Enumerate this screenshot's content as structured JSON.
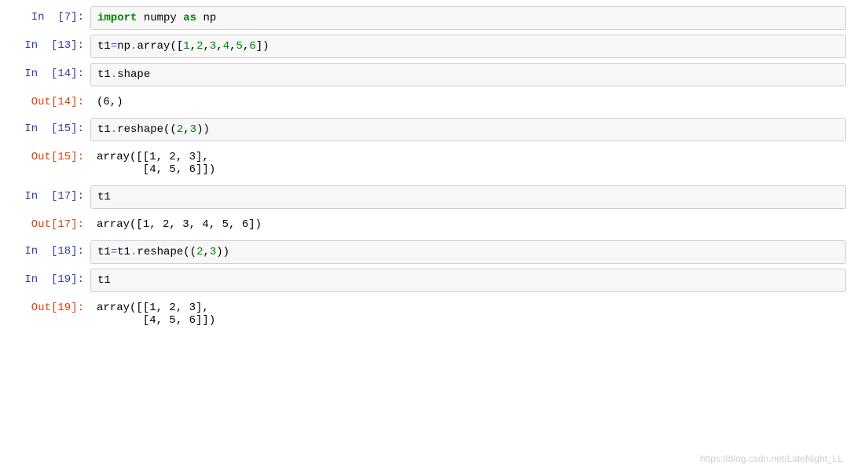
{
  "cells": [
    {
      "inPrompt": "In  [7]:",
      "inputTokens": [
        {
          "cls": "tok-kw-import",
          "text": "import"
        },
        {
          "cls": "tok-plain",
          "text": " numpy "
        },
        {
          "cls": "tok-kw-as",
          "text": "as"
        },
        {
          "cls": "tok-plain",
          "text": " np"
        }
      ]
    },
    {
      "inPrompt": "In  [13]:",
      "inputTokens": [
        {
          "cls": "tok-plain",
          "text": "t1"
        },
        {
          "cls": "tok-op",
          "text": "="
        },
        {
          "cls": "tok-plain",
          "text": "np"
        },
        {
          "cls": "tok-op",
          "text": "."
        },
        {
          "cls": "tok-plain",
          "text": "array(["
        },
        {
          "cls": "tok-num",
          "text": "1"
        },
        {
          "cls": "tok-plain",
          "text": ","
        },
        {
          "cls": "tok-num",
          "text": "2"
        },
        {
          "cls": "tok-plain",
          "text": ","
        },
        {
          "cls": "tok-num",
          "text": "3"
        },
        {
          "cls": "tok-plain",
          "text": ","
        },
        {
          "cls": "tok-num",
          "text": "4"
        },
        {
          "cls": "tok-plain",
          "text": ","
        },
        {
          "cls": "tok-num",
          "text": "5"
        },
        {
          "cls": "tok-plain",
          "text": ","
        },
        {
          "cls": "tok-num",
          "text": "6"
        },
        {
          "cls": "tok-plain",
          "text": "])"
        }
      ]
    },
    {
      "inPrompt": "In  [14]:",
      "inputTokens": [
        {
          "cls": "tok-plain",
          "text": "t1"
        },
        {
          "cls": "tok-op",
          "text": "."
        },
        {
          "cls": "tok-plain",
          "text": "shape"
        }
      ],
      "outPrompt": "Out[14]:",
      "outputText": "(6,)"
    },
    {
      "inPrompt": "In  [15]:",
      "inputTokens": [
        {
          "cls": "tok-plain",
          "text": "t1"
        },
        {
          "cls": "tok-op",
          "text": "."
        },
        {
          "cls": "tok-plain",
          "text": "reshape(("
        },
        {
          "cls": "tok-num",
          "text": "2"
        },
        {
          "cls": "tok-plain",
          "text": ","
        },
        {
          "cls": "tok-num",
          "text": "3"
        },
        {
          "cls": "tok-plain",
          "text": "))"
        }
      ],
      "outPrompt": "Out[15]:",
      "outputText": "array([[1, 2, 3],\n       [4, 5, 6]])"
    },
    {
      "inPrompt": "In  [17]:",
      "inputTokens": [
        {
          "cls": "tok-plain",
          "text": "t1"
        }
      ],
      "outPrompt": "Out[17]:",
      "outputText": "array([1, 2, 3, 4, 5, 6])"
    },
    {
      "inPrompt": "In  [18]:",
      "inputTokens": [
        {
          "cls": "tok-plain",
          "text": "t1"
        },
        {
          "cls": "tok-op",
          "text": "="
        },
        {
          "cls": "tok-plain",
          "text": "t1"
        },
        {
          "cls": "tok-op",
          "text": "."
        },
        {
          "cls": "tok-plain",
          "text": "reshape(("
        },
        {
          "cls": "tok-num",
          "text": "2"
        },
        {
          "cls": "tok-plain",
          "text": ","
        },
        {
          "cls": "tok-num",
          "text": "3"
        },
        {
          "cls": "tok-plain",
          "text": "))"
        }
      ]
    },
    {
      "inPrompt": "In  [19]:",
      "inputTokens": [
        {
          "cls": "tok-plain",
          "text": "t1"
        }
      ],
      "outPrompt": "Out[19]:",
      "outputText": "array([[1, 2, 3],\n       [4, 5, 6]])"
    }
  ],
  "watermark": "https://blog.csdn.net/LateNight_LL"
}
